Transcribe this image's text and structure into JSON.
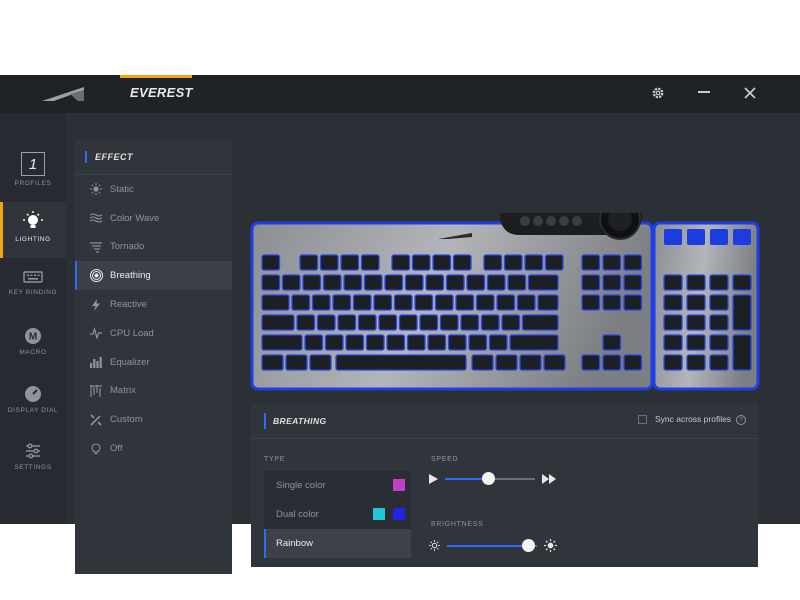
{
  "app": {
    "title": "EVEREST",
    "colors": {
      "accent": "#f2a71b",
      "highlight": "#2f6cf6",
      "background": "#2b2f36"
    }
  },
  "titlebar": {
    "icons": [
      "gear-icon",
      "minimize-icon",
      "close-icon"
    ]
  },
  "sidenav": {
    "items": [
      {
        "label": "PROFILES",
        "value": "1",
        "icon": "profile-number"
      },
      {
        "label": "LIGHTING",
        "icon": "bulb-icon",
        "active": true
      },
      {
        "label": "KEY BINDING",
        "icon": "keyboard-icon"
      },
      {
        "label": "MACRO",
        "icon": "macro-icon"
      },
      {
        "label": "DISPLAY DIAL",
        "icon": "dial-icon"
      },
      {
        "label": "SETTINGS",
        "icon": "sliders-icon"
      }
    ]
  },
  "effects": {
    "title": "EFFECT",
    "items": [
      {
        "label": "Static",
        "icon": "sun-icon"
      },
      {
        "label": "Color Wave",
        "icon": "wave-icon"
      },
      {
        "label": "Tornado",
        "icon": "tornado-icon"
      },
      {
        "label": "Breathing",
        "icon": "breathing-icon",
        "active": true
      },
      {
        "label": "Reactive",
        "icon": "bolt-icon"
      },
      {
        "label": "CPU Load",
        "icon": "pulse-icon"
      },
      {
        "label": "Equalizer",
        "icon": "equalizer-icon"
      },
      {
        "label": "Matrix",
        "icon": "matrix-icon"
      },
      {
        "label": "Custom",
        "icon": "custom-icon"
      },
      {
        "label": "Off",
        "icon": "off-bulb-icon"
      }
    ]
  },
  "panel": {
    "title": "BREATHING",
    "sync_label": "Sync across profiles",
    "sync_checked": false,
    "help": "?",
    "type_label": "TYPE",
    "types": [
      {
        "label": "Single color",
        "colors": [
          "#c13fc9"
        ]
      },
      {
        "label": "Dual color",
        "colors": [
          "#20c7d9",
          "#2323e0"
        ]
      },
      {
        "label": "Rainbow",
        "active": true
      }
    ],
    "speed_label": "SPEED",
    "speed_value": 0.48,
    "brightness_label": "BRIGHTNESS",
    "brightness_value": 0.9
  }
}
